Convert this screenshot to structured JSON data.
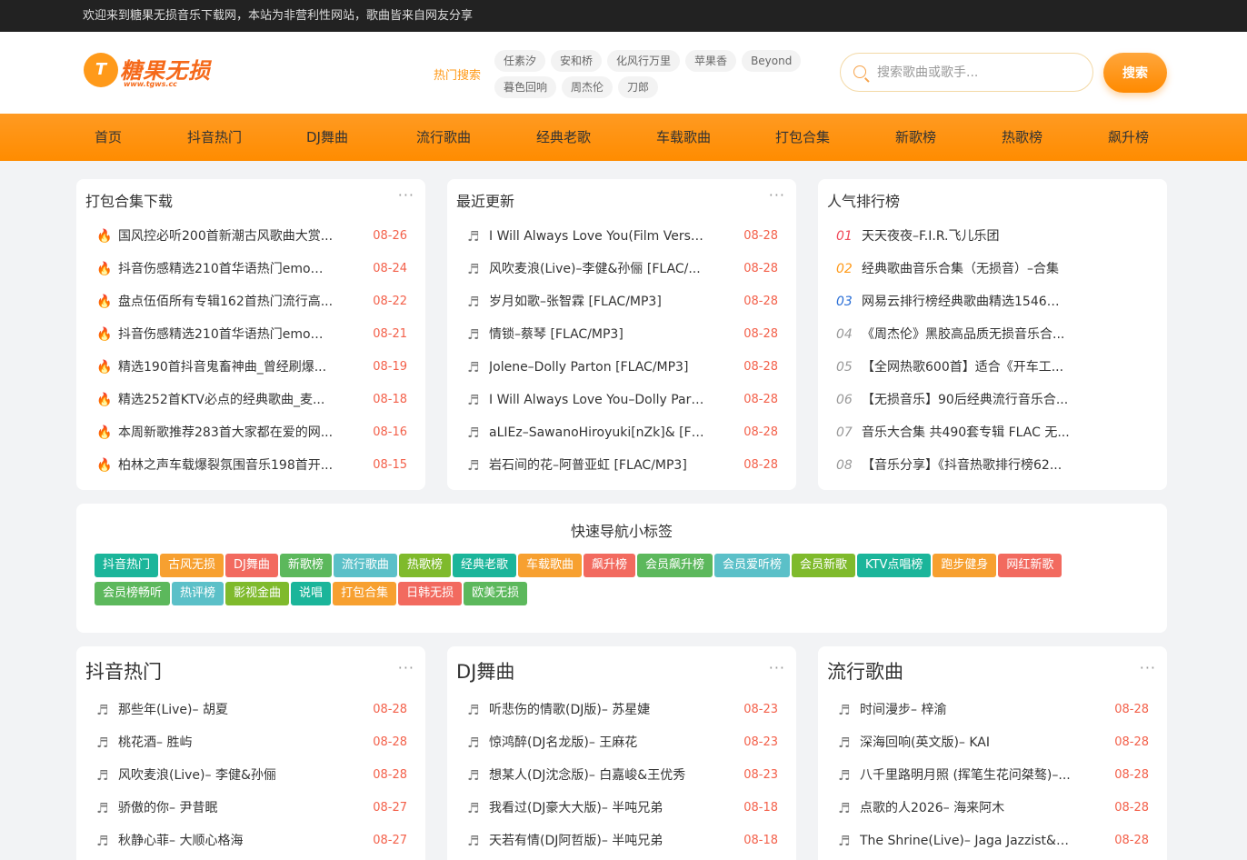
{
  "topbar": {
    "text": "欢迎来到糖果无损音乐下载网，本站为非营利性网站，歌曲皆来自网友分享"
  },
  "logo": {
    "mark": "T",
    "title": "糖果无损",
    "url": "www.tgws.cc"
  },
  "hot_search": {
    "label": "热门搜索",
    "tags": [
      "任素汐",
      "安和桥",
      "化风行万里",
      "苹果香",
      "Beyond",
      "暮色回响",
      "周杰伦",
      "刀郎"
    ]
  },
  "search": {
    "placeholder": "搜索歌曲或歌手...",
    "button": "搜索"
  },
  "nav": [
    "首页",
    "抖音热门",
    "DJ舞曲",
    "流行歌曲",
    "经典老歌",
    "车载歌曲",
    "打包合集",
    "新歌榜",
    "热歌榜",
    "飙升榜"
  ],
  "packs": {
    "title": "打包合集下载",
    "more": "···",
    "items": [
      {
        "text": "国风控必听200首新潮古风歌曲大赏...",
        "date": "08-26"
      },
      {
        "text": "抖音伤感精选210首华语热门emo单...",
        "date": "08-24"
      },
      {
        "text": "盘点伍佰所有专辑162首热门流行高...",
        "date": "08-22"
      },
      {
        "text": "抖音伤感精选210首华语热门emo单...",
        "date": "08-21"
      },
      {
        "text": "精选190首抖音鬼畜神曲_曾经刷爆...",
        "date": "08-19"
      },
      {
        "text": "精选252首KTV必点的经典歌曲_麦...",
        "date": "08-18"
      },
      {
        "text": "本周新歌推荐283首大家都在爱的网...",
        "date": "08-16"
      },
      {
        "text": "柏林之声车载爆裂氛围音乐198首开...",
        "date": "08-15"
      }
    ]
  },
  "recent": {
    "title": "最近更新",
    "more": "···",
    "items": [
      {
        "text": "I Will Always Love You(Film Versi...",
        "date": "08-28"
      },
      {
        "text": "风吹麦浪(Live)–李健&孙俪 [FLAC/...",
        "date": "08-28"
      },
      {
        "text": "岁月如歌–张智霖 [FLAC/MP3]",
        "date": "08-28"
      },
      {
        "text": "情锁–蔡琴 [FLAC/MP3]",
        "date": "08-28"
      },
      {
        "text": "Jolene–Dolly Parton [FLAC/MP3]",
        "date": "08-28"
      },
      {
        "text": "I Will Always Love You–Dolly Part...",
        "date": "08-28"
      },
      {
        "text": "aLIEz–SawanoHiroyuki[nZk]& [FL...",
        "date": "08-28"
      },
      {
        "text": "岩石间的花–阿普亚虹 [FLAC/MP3]",
        "date": "08-28"
      }
    ]
  },
  "ranking": {
    "title": "人气排行榜",
    "items": [
      {
        "num": "01",
        "text": "天天夜夜–F.I.R.飞儿乐团"
      },
      {
        "num": "02",
        "text": "经典歌曲音乐合集（无损音）–合集"
      },
      {
        "num": "03",
        "text": "网易云排行榜经典歌曲精选1546首..."
      },
      {
        "num": "04",
        "text": "《周杰伦》黑胶高品质无损音乐合..."
      },
      {
        "num": "05",
        "text": "【全网热歌600首】适合《开车工..."
      },
      {
        "num": "06",
        "text": "【无损音乐】90后经典流行音乐合..."
      },
      {
        "num": "07",
        "text": "音乐大合集 共490套专辑 FLAC 无..."
      },
      {
        "num": "08",
        "text": "【音乐分享】《抖音热歌排行榜62..."
      }
    ]
  },
  "quick_nav": {
    "title": "快速导航小标签",
    "tags": [
      {
        "label": "抖音热门",
        "color": "#1bb59a"
      },
      {
        "label": "古风无损",
        "color": "#f7a030"
      },
      {
        "label": "DJ舞曲",
        "color": "#f26a5f"
      },
      {
        "label": "新歌榜",
        "color": "#5cb85c"
      },
      {
        "label": "流行歌曲",
        "color": "#5bc0c8"
      },
      {
        "label": "热歌榜",
        "color": "#7fba2c"
      },
      {
        "label": "经典老歌",
        "color": "#1bb59a"
      },
      {
        "label": "车载歌曲",
        "color": "#f7a030"
      },
      {
        "label": "飙升榜",
        "color": "#f26a5f"
      },
      {
        "label": "会员飙升榜",
        "color": "#5cb85c"
      },
      {
        "label": "会员爱听榜",
        "color": "#5bc0c8"
      },
      {
        "label": "会员新歌",
        "color": "#7fba2c"
      },
      {
        "label": "KTV点唱榜",
        "color": "#1bb59a"
      },
      {
        "label": "跑步健身",
        "color": "#f7a030"
      },
      {
        "label": "网红新歌",
        "color": "#f26a5f"
      },
      {
        "label": "会员榜畅听",
        "color": "#5cb85c"
      },
      {
        "label": "热评榜",
        "color": "#5bc0c8"
      },
      {
        "label": "影视金曲",
        "color": "#7fba2c"
      },
      {
        "label": "说唱",
        "color": "#1bb59a"
      },
      {
        "label": "打包合集",
        "color": "#f7a030"
      },
      {
        "label": "日韩无损",
        "color": "#f26a5f"
      },
      {
        "label": "欧美无损",
        "color": "#5cb85c"
      }
    ]
  },
  "douyin": {
    "title": "抖音热门",
    "more": "···",
    "items": [
      {
        "text": "那些年(Live)– 胡夏",
        "date": "08-28"
      },
      {
        "text": "桃花酒– 胜屿",
        "date": "08-28"
      },
      {
        "text": "风吹麦浪(Live)– 李健&孙俪",
        "date": "08-28"
      },
      {
        "text": "骄傲的你– 尹昔眠",
        "date": "08-27"
      },
      {
        "text": "秋静心菲– 大顺心格海",
        "date": "08-27"
      }
    ]
  },
  "dj": {
    "title": "DJ舞曲",
    "more": "···",
    "items": [
      {
        "text": "听悲伤的情歌(DJ版)– 苏星婕",
        "date": "08-23"
      },
      {
        "text": "惊鸿醉(DJ名龙版)– 王麻花",
        "date": "08-23"
      },
      {
        "text": "想某人(DJ沈念版)– 白嘉峻&王优秀",
        "date": "08-23"
      },
      {
        "text": "我看过(DJ豪大大版)– 半吨兄弟",
        "date": "08-18"
      },
      {
        "text": "天若有情(DJ阿哲版)– 半吨兄弟",
        "date": "08-18"
      }
    ]
  },
  "pop": {
    "title": "流行歌曲",
    "more": "···",
    "items": [
      {
        "text": "时间漫步– 梓渝",
        "date": "08-28"
      },
      {
        "text": "深海回响(英文版)– KAI",
        "date": "08-28"
      },
      {
        "text": "八千里路明月照 (挥笔生花问桀骜)–...",
        "date": "08-28"
      },
      {
        "text": "点歌的人2026– 海来阿木",
        "date": "08-28"
      },
      {
        "text": "The Shrine(Live)– Jaga Jazzist&T...",
        "date": "08-28"
      }
    ]
  }
}
